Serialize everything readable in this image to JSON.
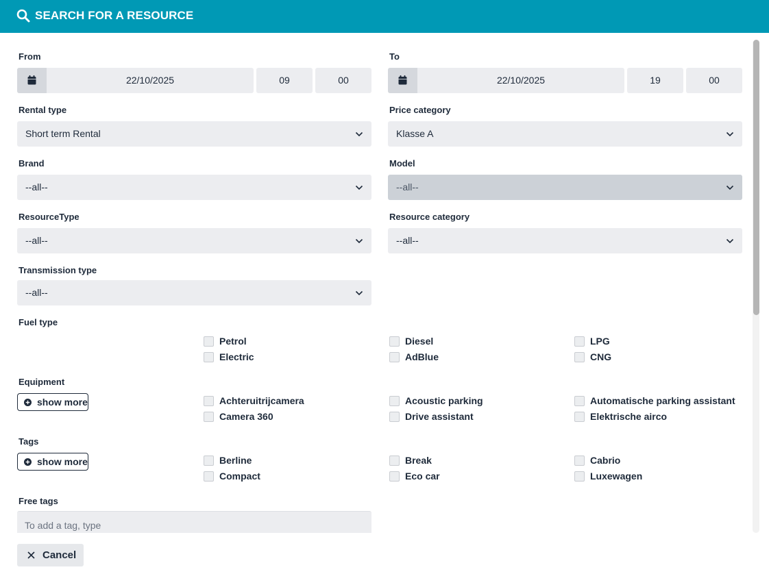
{
  "header": {
    "title": "SEARCH FOR A RESOURCE",
    "icon": "search-icon",
    "color": "#0099b5"
  },
  "from": {
    "label": "From",
    "date": "22/10/2025",
    "hour": "09",
    "minute": "00"
  },
  "to": {
    "label": "To",
    "date": "22/10/2025",
    "hour": "19",
    "minute": "00"
  },
  "rental_type": {
    "label": "Rental type",
    "value": "Short term Rental"
  },
  "price_category": {
    "label": "Price category",
    "value": "Klasse A"
  },
  "brand": {
    "label": "Brand",
    "value": "--all--"
  },
  "model": {
    "label": "Model",
    "value": "--all--",
    "disabled": true
  },
  "resource_type": {
    "label": "ResourceType",
    "value": "--all--"
  },
  "resource_category": {
    "label": "Resource category",
    "value": "--all--"
  },
  "transmission_type": {
    "label": "Transmission type",
    "value": "--all--"
  },
  "fuel_type": {
    "label": "Fuel type",
    "options": [
      "Petrol",
      "Diesel",
      "LPG",
      "Electric",
      "AdBlue",
      "CNG"
    ]
  },
  "equipment": {
    "label": "Equipment",
    "show_more": "show more",
    "options": [
      "Achteruitrijcamera",
      "Acoustic parking",
      "Automatische parking assistant",
      "Camera 360",
      "Drive assistant",
      "Elektrische airco"
    ]
  },
  "tags": {
    "label": "Tags",
    "show_more": "show more",
    "options": [
      "Berline",
      "Break",
      "Cabrio",
      "Compact",
      "Eco car",
      "Luxewagen"
    ]
  },
  "free_tags": {
    "label": "Free tags",
    "placeholder": "To add a tag, type"
  },
  "footer": {
    "cancel_label": "Cancel"
  }
}
